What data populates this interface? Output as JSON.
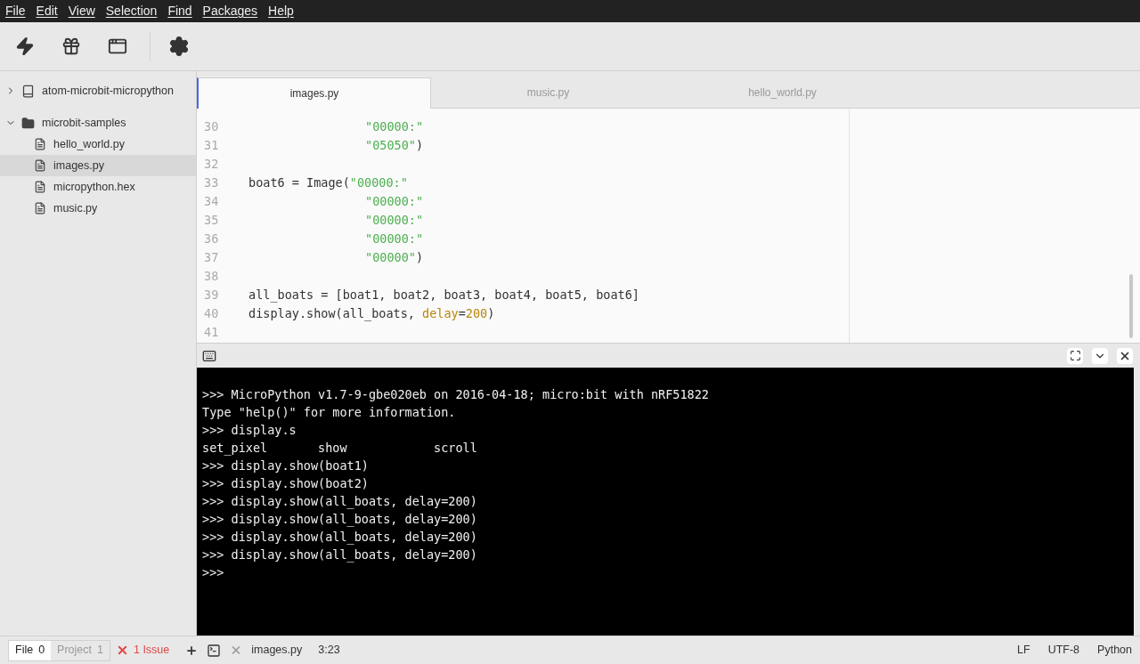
{
  "menu": [
    "File",
    "Edit",
    "View",
    "Selection",
    "Find",
    "Packages",
    "Help"
  ],
  "toolbar": [
    {
      "kind": "flash"
    },
    {
      "kind": "gift"
    },
    {
      "kind": "window"
    },
    {
      "kind": "settings"
    }
  ],
  "tree": [
    {
      "label": "atom-microbit-micropython",
      "kind": "repo",
      "expanded": false,
      "selected": false
    },
    {
      "label": "microbit-samples",
      "kind": "folder",
      "expanded": true,
      "selected": false,
      "children": [
        {
          "label": "hello_world.py",
          "kind": "file",
          "selected": false
        },
        {
          "label": "images.py",
          "kind": "file",
          "selected": true
        },
        {
          "label": "micropython.hex",
          "kind": "file",
          "selected": false
        },
        {
          "label": "music.py",
          "kind": "file",
          "selected": false
        }
      ]
    }
  ],
  "tabs": [
    {
      "label": "images.py",
      "selected": true
    },
    {
      "label": "music.py",
      "selected": false
    },
    {
      "label": "hello_world.py",
      "selected": false
    }
  ],
  "code": [
    {
      "number": "30",
      "kind": "continuation",
      "tokens": [
        {
          "kind": "string",
          "text": "\"00000:\""
        }
      ]
    },
    {
      "number": "31",
      "kind": "continuation",
      "tokens": [
        {
          "kind": "string",
          "text": "\"05050\""
        },
        {
          "kind": "plain",
          "text": ")"
        }
      ]
    },
    {
      "number": "32",
      "kind": "blank"
    },
    {
      "number": "33",
      "kind": "statement",
      "tokens": [
        {
          "kind": "plain",
          "text": "boat6 = Image("
        },
        {
          "kind": "string",
          "text": "\"00000:\""
        }
      ]
    },
    {
      "number": "34",
      "kind": "continuation",
      "tokens": [
        {
          "kind": "string",
          "text": "\"00000:\""
        }
      ]
    },
    {
      "number": "35",
      "kind": "continuation",
      "tokens": [
        {
          "kind": "string",
          "text": "\"00000:\""
        }
      ]
    },
    {
      "number": "36",
      "kind": "continuation",
      "tokens": [
        {
          "kind": "string",
          "text": "\"00000:\""
        }
      ]
    },
    {
      "number": "37",
      "kind": "continuation",
      "tokens": [
        {
          "kind": "string",
          "text": "\"00000\""
        },
        {
          "kind": "plain",
          "text": ")"
        }
      ]
    },
    {
      "number": "38",
      "kind": "blank"
    },
    {
      "number": "39",
      "kind": "statement",
      "tokens": [
        {
          "kind": "plain",
          "text": "all_boats = [boat1, boat2, boat3, boat4, boat5, boat6]"
        }
      ]
    },
    {
      "number": "40",
      "kind": "statement",
      "tokens": [
        {
          "kind": "plain",
          "text": "display.show(all_boats, "
        },
        {
          "kind": "param",
          "text": "delay"
        },
        {
          "kind": "plain",
          "text": "="
        },
        {
          "kind": "number",
          "text": "200"
        },
        {
          "kind": "plain",
          "text": ")"
        }
      ]
    },
    {
      "number": "41",
      "kind": "blank"
    }
  ],
  "terminal": [
    ">>> MicroPython v1.7-9-gbe020eb on 2016-04-18; micro:bit with nRF51822",
    "Type \"help()\" for more information.",
    ">>> display.s",
    "set_pixel       show            scroll",
    ">>> display.show(boat1)",
    ">>> display.show(boat2)",
    ">>> display.show(all_boats, delay=200)",
    ">>> display.show(all_boats, delay=200)",
    ">>> display.show(all_boats, delay=200)",
    ">>> display.show(all_boats, delay=200)",
    ">>>"
  ],
  "status_bar": {
    "tabs": [
      {
        "label": "File",
        "count": "0",
        "selected": true
      },
      {
        "label": "Project",
        "count": "1",
        "selected": false
      }
    ],
    "issues": "1 Issue",
    "file": "images.py",
    "cursor": "3:23",
    "right": [
      "LF",
      "UTF-8",
      "Python"
    ]
  }
}
